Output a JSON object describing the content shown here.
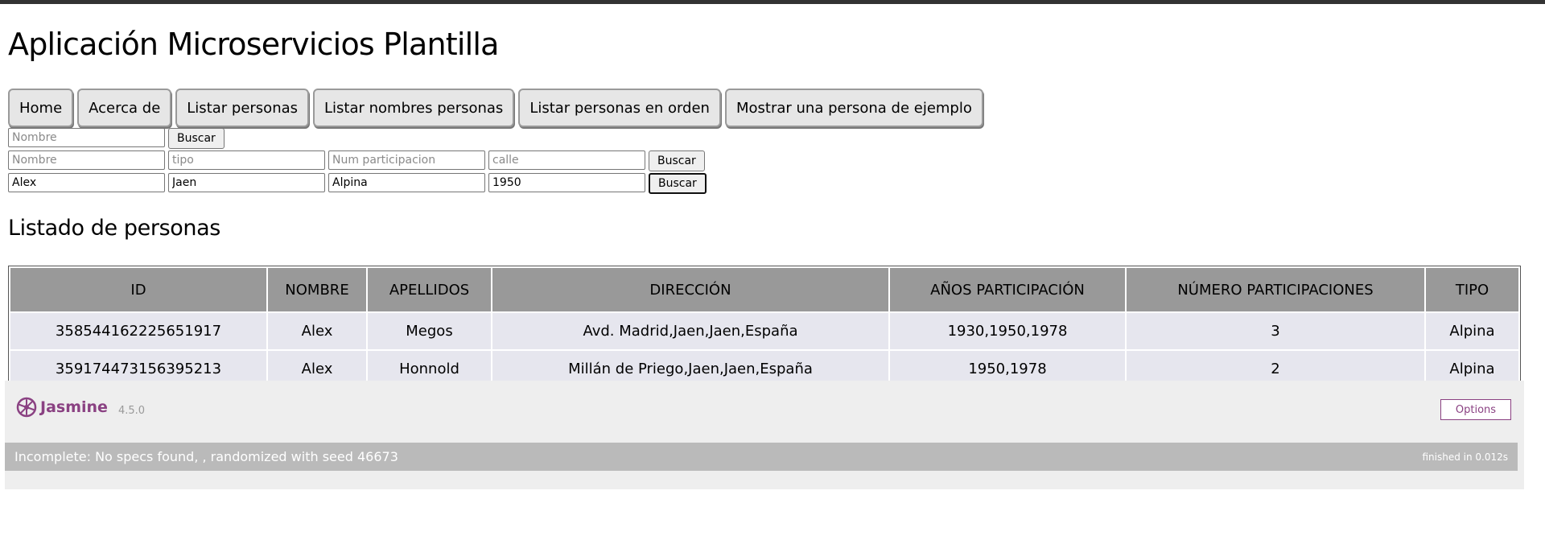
{
  "app": {
    "title": "Aplicación Microservicios Plantilla"
  },
  "nav": [
    {
      "label": "Home"
    },
    {
      "label": "Acerca de"
    },
    {
      "label": "Listar personas"
    },
    {
      "label": "Listar nombres personas"
    },
    {
      "label": "Listar personas en orden"
    },
    {
      "label": "Mostrar una persona de ejemplo"
    }
  ],
  "search_simple": {
    "name_placeholder": "Nombre",
    "name_value": "",
    "button_label": "Buscar"
  },
  "search_advanced_1": {
    "name_placeholder": "Nombre",
    "tipo_placeholder": "tipo",
    "num_placeholder": "Num participacion",
    "calle_placeholder": "calle",
    "name_value": "",
    "tipo_value": "",
    "num_value": "",
    "calle_value": "",
    "button_label": "Buscar"
  },
  "search_advanced_2": {
    "name_value": "Alex",
    "tipo_value": "Jaen",
    "num_value": "Alpina",
    "calle_value": "1950",
    "button_label": "Buscar"
  },
  "list": {
    "heading": "Listado de personas",
    "columns": [
      "ID",
      "NOMBRE",
      "APELLIDOS",
      "DIRECCIÓN",
      "AÑOS PARTICIPACIÓN",
      "NÚMERO PARTICIPACIONES",
      "TIPO"
    ],
    "rows": [
      [
        "358544162225651917",
        "Alex",
        "Megos",
        "Avd. Madrid,Jaen,Jaen,España",
        "1930,1950,1978",
        "3",
        "Alpina"
      ],
      [
        "359174473156395213",
        "Alex",
        "Honnold",
        "Millán de Priego,Jaen,Jaen,España",
        "1950,1978",
        "2",
        "Alpina"
      ]
    ]
  },
  "jasmine": {
    "logo_text": "Jasmine",
    "version": "4.5.0",
    "options_label": "Options",
    "status_prefix": "Incomplete: No specs found, , randomized with seed",
    "seed": "46673",
    "duration": "finished in 0.012s",
    "brand_color": "#8a4182"
  }
}
